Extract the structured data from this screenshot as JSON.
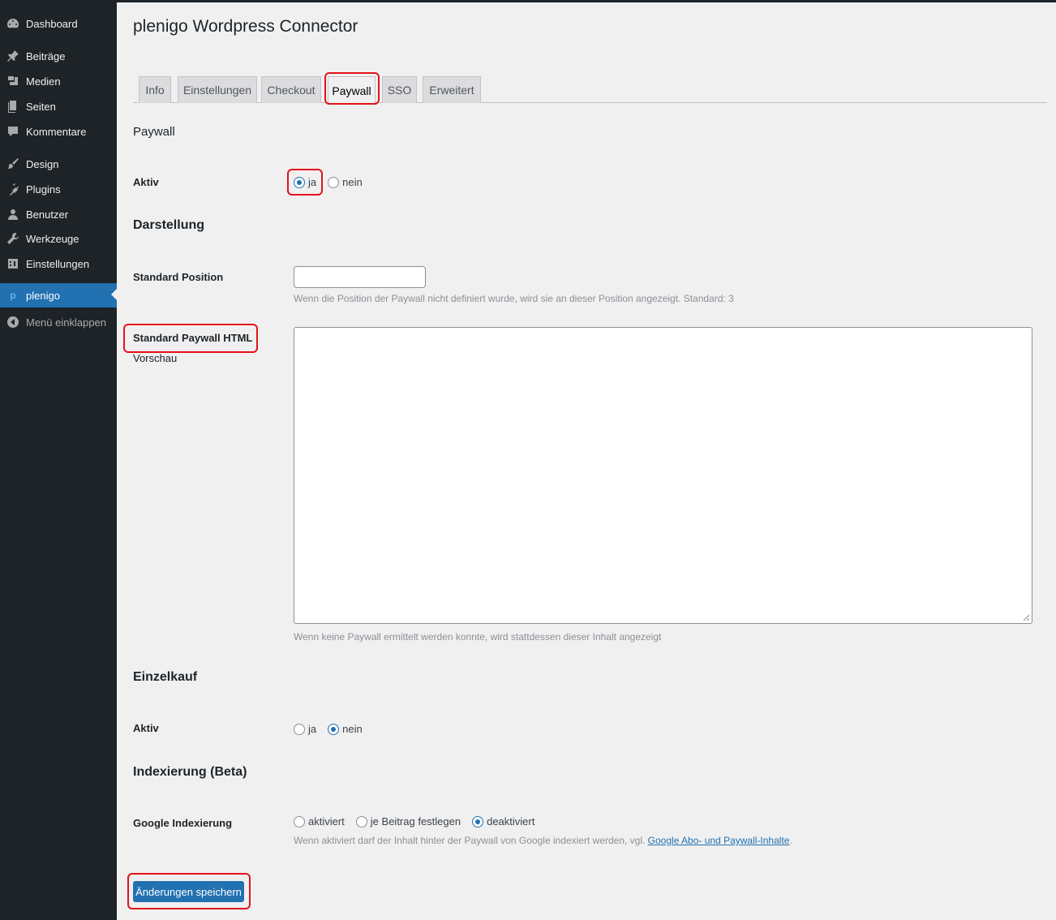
{
  "sidebar": {
    "items": [
      {
        "label": "Dashboard",
        "icon": "dashboard-icon"
      },
      {
        "label": "Beiträge",
        "icon": "pin-icon"
      },
      {
        "label": "Medien",
        "icon": "media-icon"
      },
      {
        "label": "Seiten",
        "icon": "pages-icon"
      },
      {
        "label": "Kommentare",
        "icon": "comment-icon"
      },
      {
        "label": "Design",
        "icon": "brush-icon"
      },
      {
        "label": "Plugins",
        "icon": "plugin-icon"
      },
      {
        "label": "Benutzer",
        "icon": "user-icon"
      },
      {
        "label": "Werkzeuge",
        "icon": "wrench-icon"
      },
      {
        "label": "Einstellungen",
        "icon": "settings-icon"
      },
      {
        "label": "plenigo",
        "icon": "plenigo-icon"
      },
      {
        "label": "Menü einklappen",
        "icon": "collapse-icon"
      }
    ]
  },
  "page": {
    "title": "plenigo Wordpress Connector"
  },
  "tabs": [
    "Info",
    "Einstellungen",
    "Checkout",
    "Paywall",
    "SSO",
    "Erweitert"
  ],
  "paywall": {
    "section_title": "Paywall",
    "aktiv_label": "Aktiv",
    "ja": "ja",
    "nein": "nein"
  },
  "darstellung": {
    "section_title": "Darstellung",
    "std_position_label": "Standard Position",
    "std_position_value": "",
    "std_position_desc": "Wenn die Position der Paywall nicht definiert wurde, wird sie an dieser Position angezeigt. Standard: 3",
    "std_html_label": "Standard Paywall HTML",
    "vorschau": "Vorschau",
    "std_html_desc": "Wenn keine Paywall ermittelt werden konnte, wird stattdessen dieser Inhalt angezeigt"
  },
  "einzelkauf": {
    "section_title": "Einzelkauf",
    "aktiv_label": "Aktiv",
    "ja": "ja",
    "nein": "nein"
  },
  "indexierung": {
    "section_title": "Indexierung (Beta)",
    "label": "Google Indexierung",
    "opt_aktiviert": "aktiviert",
    "opt_je_beitrag": "je Beitrag festlegen",
    "opt_deaktiviert": "deaktiviert",
    "desc_prefix": "Wenn aktiviert darf der Inhalt hinter der Paywall von Google indexiert werden, vgl. ",
    "desc_link": "Google Abo- und Paywall-Inhalte",
    "desc_suffix": "."
  },
  "save_label": "Änderungen speichern",
  "colors": {
    "accent": "#2271b1",
    "sidebar": "#1d2327",
    "highlight": "#e3121a"
  }
}
